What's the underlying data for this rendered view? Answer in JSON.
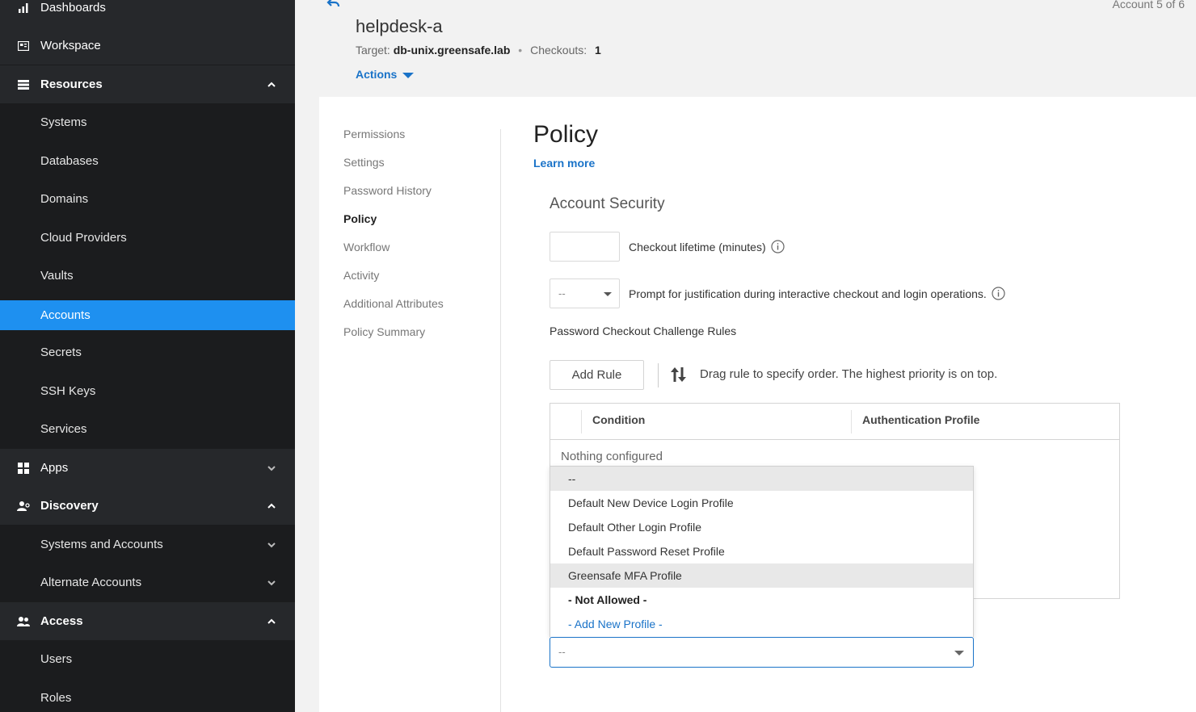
{
  "sidebar": {
    "items": [
      {
        "label": "Dashboards",
        "icon": "bar-chart-icon"
      },
      {
        "label": "Workspace",
        "icon": "workspace-icon"
      },
      {
        "label": "Resources",
        "icon": "list-icon",
        "expanded": true
      },
      {
        "label": "Systems"
      },
      {
        "label": "Databases"
      },
      {
        "label": "Domains"
      },
      {
        "label": "Cloud Providers"
      },
      {
        "label": "Vaults"
      },
      {
        "label": "Accounts",
        "active": true
      },
      {
        "label": "Secrets"
      },
      {
        "label": "SSH Keys"
      },
      {
        "label": "Services"
      },
      {
        "label": "Apps",
        "icon": "grid-icon",
        "expanded": false
      },
      {
        "label": "Discovery",
        "icon": "discovery-icon",
        "expanded": true
      },
      {
        "label": "Systems and Accounts",
        "expanded": false
      },
      {
        "label": "Alternate Accounts",
        "expanded": false
      },
      {
        "label": "Access",
        "icon": "users-icon",
        "expanded": true
      },
      {
        "label": "Users"
      },
      {
        "label": "Roles"
      }
    ]
  },
  "header": {
    "title": "helpdesk-a",
    "target_label": "Target:",
    "target_value": "db-unix.greensafe.lab",
    "checkouts_label": "Checkouts:",
    "checkouts_value": "1",
    "actions_label": "Actions",
    "counter": "Account 5 of 6"
  },
  "subnav": {
    "items": [
      "Permissions",
      "Settings",
      "Password History",
      "Policy",
      "Workflow",
      "Activity",
      "Additional Attributes",
      "Policy Summary"
    ],
    "current": "Policy"
  },
  "content": {
    "title": "Policy",
    "learn_more": "Learn more",
    "section_title": "Account Security",
    "checkout_lifetime_label": "Checkout lifetime (minutes)",
    "checkout_lifetime_value": "",
    "justification_value": "--",
    "justification_label": "Prompt for justification during interactive checkout and login operations.",
    "challenge_rules_label": "Password Checkout Challenge Rules",
    "add_rule_label": "Add Rule",
    "drag_hint": "Drag rule to specify order. The highest priority is on top.",
    "table": {
      "columns": [
        "Condition",
        "Authentication Profile"
      ],
      "empty_message": "Nothing configured"
    },
    "dropdown": {
      "options": [
        "--",
        "Default New Device Login Profile",
        "Default Other Login Profile",
        "Default Password Reset Profile",
        "Greensafe MFA Profile",
        "- Not Allowed -",
        "- Add New Profile -"
      ],
      "selected_value": "--"
    }
  },
  "colors": {
    "accent": "#1e90f0",
    "link": "#1a73c8",
    "sidebar_bg": "#1b1c1e",
    "sidebar_section_bg": "#26282b"
  }
}
